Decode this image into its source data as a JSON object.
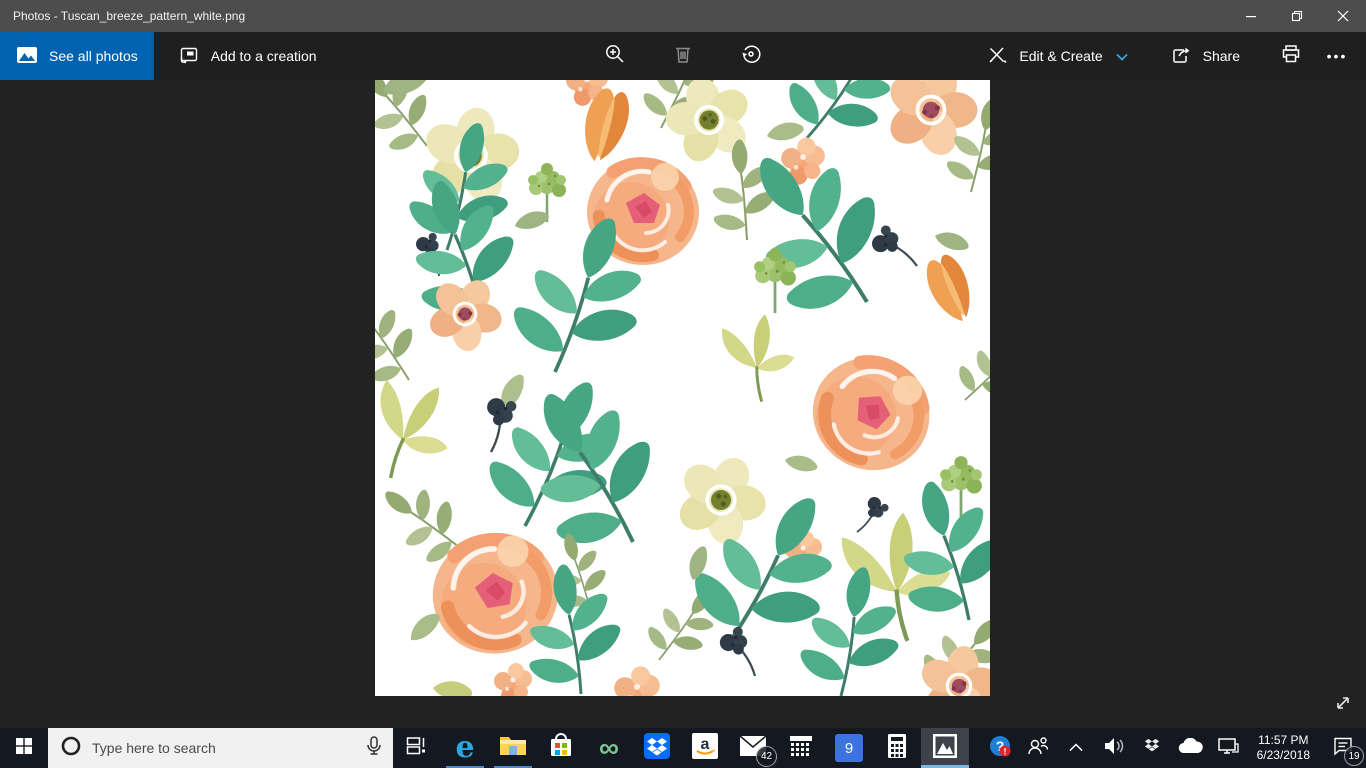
{
  "window": {
    "title": "Photos - Tuscan_breeze_pattern_white.png"
  },
  "command_bar": {
    "see_all_photos_label": "See all photos",
    "add_to_creation_label": "Add to a creation",
    "edit_create_label": "Edit & Create",
    "share_label": "Share"
  },
  "icons": {
    "center_toolbar": [
      "zoom-icon",
      "delete-icon",
      "rotate-icon"
    ],
    "right_toolbar": [
      "edit-create-icon",
      "chevron-down-icon",
      "share-icon",
      "print-icon",
      "see-more-icon"
    ],
    "window_controls": [
      "minimize-icon",
      "restore-icon",
      "close-icon"
    ],
    "edge_glyph": "e",
    "infinity_glyph": "∞",
    "see_more_glyph": "•••"
  },
  "taskbar": {
    "search_placeholder": "Type here to search",
    "apps": [
      "edge",
      "file-explorer",
      "microsoft-store",
      "infinity-app",
      "dropbox",
      "amazon",
      "mail",
      "calendar",
      "google-calendar",
      "calculator",
      "photos"
    ],
    "running_apps": [
      "edge",
      "file-explorer"
    ],
    "active_app": "photos",
    "mail_badge": "42",
    "google_calendar_day": "9"
  },
  "tray": {
    "time": "11:57 PM",
    "date": "6/23/2018",
    "notification_badge": "19",
    "icons": [
      "help-icon",
      "people-icon",
      "chevron-up-icon",
      "volume-icon",
      "dropbox-tray-icon",
      "onedrive-icon",
      "network-icon",
      "action-center-icon"
    ]
  },
  "colors": {
    "accent_blue": "#0063b1",
    "titlebar_gray": "#4d4d4d",
    "command_bar": "#1f1f1f",
    "content_background": "#222222",
    "taskbar": "#141820",
    "running_underline": "#4d87c7",
    "active_underline": "#79b7e8",
    "edit_chevron_blue": "#3aa0e8"
  }
}
